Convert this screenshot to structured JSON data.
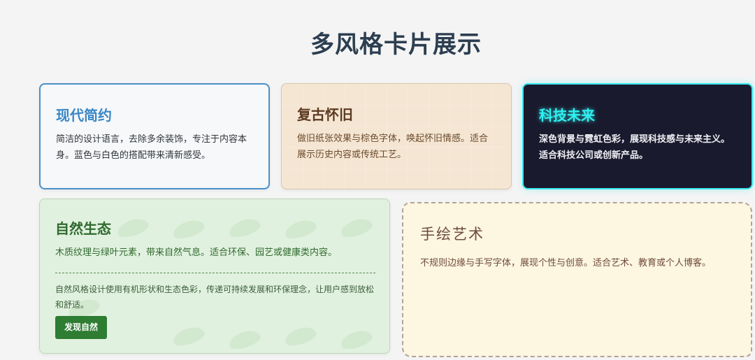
{
  "page": {
    "title": "多风格卡片展示"
  },
  "cards": {
    "modern": {
      "title": "现代简约",
      "description": "简洁的设计语言，去除多余装饰，专注于内容本身。蓝色与白色的搭配带来清新感受。"
    },
    "retro": {
      "title": "复古怀旧",
      "description": "做旧纸张效果与棕色字体，唤起怀旧情感。适合展示历史内容或传统工艺。"
    },
    "tech": {
      "title": "科技未来",
      "description": "深色背景与霓虹色彩，展现科技感与未来主义。适合科技公司或创新产品。"
    },
    "nature": {
      "title": "自然生态",
      "description": "木质纹理与绿叶元素，带来自然气息。适合环保、园艺或健康类内容。",
      "extra": "自然风格设计使用有机形状和生态色彩，传递可持续发展和环保理念，让用户感到放松和舒适。",
      "button_label": "发现自然"
    },
    "hand_drawn": {
      "title": "手绘艺术",
      "description": "不规则边缘与手写字体，展现个性与创意。适合艺术、教育或个人博客。"
    }
  },
  "colors": {
    "title": "#2c3e50",
    "modern_accent": "#3a87c4",
    "retro_bg": "#f5e6d3",
    "tech_bg": "#1a1a2e",
    "tech_neon": "#2ff1f1",
    "nature_bg": "#e1f1df",
    "nature_button": "#2e7d32",
    "hand_bg": "#fdf6e0"
  }
}
